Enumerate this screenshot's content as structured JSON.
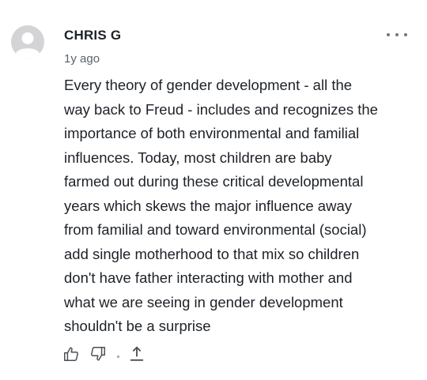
{
  "comment": {
    "author": "CHRIS G",
    "time_ago": "1y ago",
    "body_lines": [
      "Every theory of gender development - all the",
      "way back to Freud - includes and recognizes the",
      "importance of both environmental and familial",
      "influences.  Today, most children are baby",
      "farmed out during these critical developmental",
      "years which skews the major influence away",
      "from familial and  toward environmental (social)",
      "add single motherhood to that mix so children",
      "don't have father interacting with mother and",
      "what we are seeing in gender development",
      "shouldn't be a surprise"
    ]
  },
  "icons": {
    "avatar": "user-silhouette-icon",
    "more": "more-options-icon",
    "like": "thumbs-up-icon",
    "dislike": "thumbs-down-icon",
    "share": "share-upload-icon"
  },
  "colors": {
    "text": "#1d2228",
    "muted": "#5b636a",
    "icon": "#4a4f55",
    "avatar_bg": "#d4d4d6"
  }
}
